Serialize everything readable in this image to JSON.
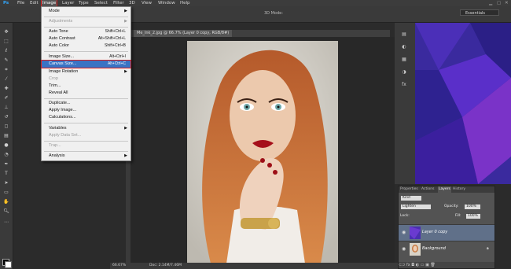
{
  "menubar": {
    "logo": "Ps",
    "items": [
      "File",
      "Edit",
      "Image",
      "Layer",
      "Type",
      "Select",
      "Filter",
      "3D",
      "View",
      "Window",
      "Help"
    ]
  },
  "options": {
    "workspace": "Essentials",
    "mode3d": "3D Mode:"
  },
  "document_tab": {
    "title": "Me_Ink_2.jpg @ 66.7% (Layer 0 copy, RGB/8#)"
  },
  "image_menu": {
    "items": [
      {
        "label": "Mode",
        "shortcut": "",
        "submenu": true,
        "disabled": false
      },
      {
        "label": "Adjustments",
        "shortcut": "",
        "submenu": true,
        "disabled": true
      },
      {
        "label": "Auto Tone",
        "shortcut": "Shift+Ctrl+L",
        "submenu": false,
        "disabled": false
      },
      {
        "label": "Auto Contrast",
        "shortcut": "Alt+Shift+Ctrl+L",
        "submenu": false,
        "disabled": false
      },
      {
        "label": "Auto Color",
        "shortcut": "Shift+Ctrl+B",
        "submenu": false,
        "disabled": false
      },
      {
        "label": "Image Size...",
        "shortcut": "Alt+Ctrl+I",
        "submenu": false,
        "disabled": false
      },
      {
        "label": "Canvas Size...",
        "shortcut": "Alt+Ctrl+C",
        "submenu": false,
        "disabled": false,
        "highlighted": true
      },
      {
        "label": "Image Rotation",
        "shortcut": "",
        "submenu": true,
        "disabled": false
      },
      {
        "label": "Crop",
        "shortcut": "",
        "submenu": false,
        "disabled": true
      },
      {
        "label": "Trim...",
        "shortcut": "",
        "submenu": false,
        "disabled": false
      },
      {
        "label": "Reveal All",
        "shortcut": "",
        "submenu": false,
        "disabled": false
      },
      {
        "label": "Duplicate...",
        "shortcut": "",
        "submenu": false,
        "disabled": false
      },
      {
        "label": "Apply Image...",
        "shortcut": "",
        "submenu": false,
        "disabled": false
      },
      {
        "label": "Calculations...",
        "shortcut": "",
        "submenu": false,
        "disabled": false
      },
      {
        "label": "Variables",
        "shortcut": "",
        "submenu": true,
        "disabled": false
      },
      {
        "label": "Apply Data Set...",
        "shortcut": "",
        "submenu": false,
        "disabled": true
      },
      {
        "label": "Trap...",
        "shortcut": "",
        "submenu": false,
        "disabled": true
      },
      {
        "label": "Analysis",
        "shortcut": "",
        "submenu": true,
        "disabled": false
      }
    ]
  },
  "layers_panel": {
    "tabs": [
      "Properties",
      "Actions",
      "Layers",
      "History"
    ],
    "active_tab": "Layers",
    "kind": "Kind",
    "blend": "Lighten",
    "opacity_label": "Opacity:",
    "opacity": "100%",
    "lock_label": "Lock:",
    "fill_label": "Fill:",
    "fill": "100%",
    "layers": [
      {
        "name": "Layer 0 copy",
        "selected": true
      },
      {
        "name": "Background",
        "selected": false
      }
    ],
    "footer_icons": "⊂⊃  fx  ◘  ◐  ▭  ▣  🗑"
  },
  "status": {
    "zoom": "66.67%",
    "doc": "Doc: 2.14M/7.46M"
  },
  "colors": {
    "accent": "#3973c4",
    "highlight_outline": "#d61f1f",
    "brand": "#31a8ff"
  }
}
